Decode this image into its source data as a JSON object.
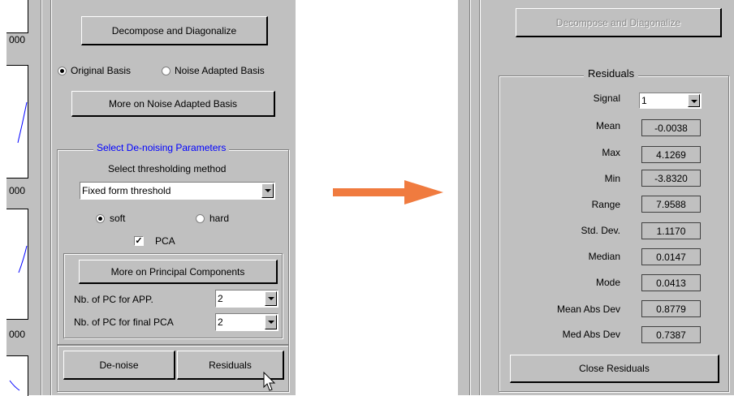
{
  "left_panel": {
    "axis_ticks": [
      "000",
      "000",
      "000"
    ],
    "decompose_label": "Decompose and Diagonalize",
    "basis_original_label": "Original Basis",
    "basis_noise_label": "Noise Adapted Basis",
    "more_noise_label": "More on Noise Adapted Basis",
    "denoise_group_title": "Select De-noising Parameters",
    "threshold_method_label": "Select thresholding method",
    "threshold_method_value": "Fixed form threshold",
    "soft_label": "soft",
    "hard_label": "hard",
    "pca_label": "PCA",
    "pca_check": "✓",
    "more_pc_label": "More on Principal Components",
    "pc_app_label": "Nb. of  PC for APP.",
    "pc_app_value": "2",
    "pc_final_label": "Nb. of PC for final PCA",
    "pc_final_value": "2",
    "denoise_button_label": "De-noise",
    "residuals_button_label": "Residuals"
  },
  "right_panel": {
    "decompose_label": "Decompose and Diagonalize",
    "residuals_group_title": "Residuals",
    "signal_label": "Signal",
    "signal_value": "1",
    "stats": [
      {
        "label": "Mean",
        "value": "-0.0038"
      },
      {
        "label": "Max",
        "value": "4.1269"
      },
      {
        "label": "Min",
        "value": "-3.8320"
      },
      {
        "label": "Range",
        "value": "7.9588"
      },
      {
        "label": "Std. Dev.",
        "value": "1.1170"
      },
      {
        "label": "Median",
        "value": "0.0147"
      },
      {
        "label": "Mode",
        "value": "0.0413"
      },
      {
        "label": "Mean Abs Dev",
        "value": "0.8779"
      },
      {
        "label": "Med Abs Dev",
        "value": "0.7387"
      }
    ],
    "close_label": "Close Residuals"
  },
  "colors": {
    "panel_bg": "#c0c0c0",
    "arrow": "#f07b3f",
    "group_title": "#0000ff",
    "plot_line": "#0000ff"
  }
}
